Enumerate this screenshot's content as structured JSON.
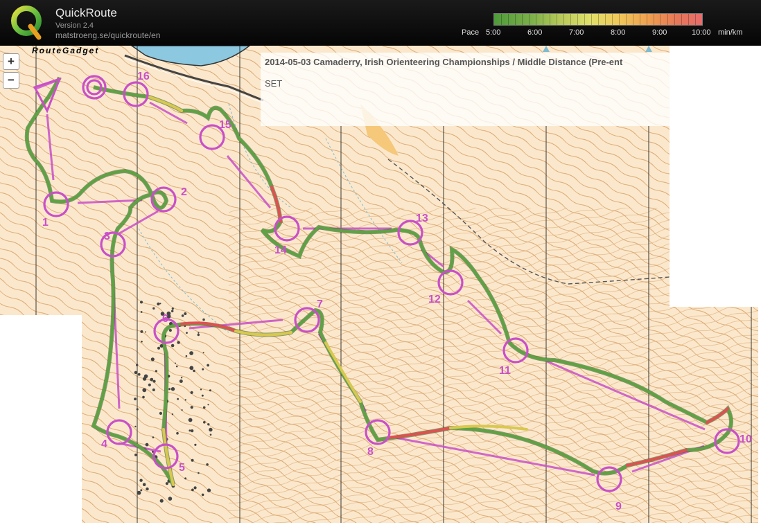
{
  "app": {
    "title": "QuickRoute",
    "version": "Version 2.4",
    "url": "matstroeng.se/quickroute/en",
    "logo_letter": "Q"
  },
  "pace_scale": {
    "label": "Pace",
    "unit": "min/km",
    "ticks": [
      "5:00",
      "6:00",
      "7:00",
      "8:00",
      "9:00",
      "10:00"
    ]
  },
  "map": {
    "logo_text": "RouteGadget",
    "zoom_in_label": "+",
    "zoom_out_label": "−",
    "info_title": "2014-05-03 Camaderry, Irish Orienteering Championships / Middle Distance (Pre-ent",
    "info_status": "SET",
    "controls": [
      "1",
      "2",
      "3",
      "4",
      "5",
      "6",
      "7",
      "8",
      "9",
      "10",
      "11",
      "12",
      "13",
      "14",
      "15",
      "16"
    ]
  },
  "colors": {
    "map_paper": "#fbe8cc",
    "contour": "#d8a068",
    "course_magenta": "#c94fc9",
    "route_green": "#4f9a3b",
    "route_red": "#e05050"
  }
}
